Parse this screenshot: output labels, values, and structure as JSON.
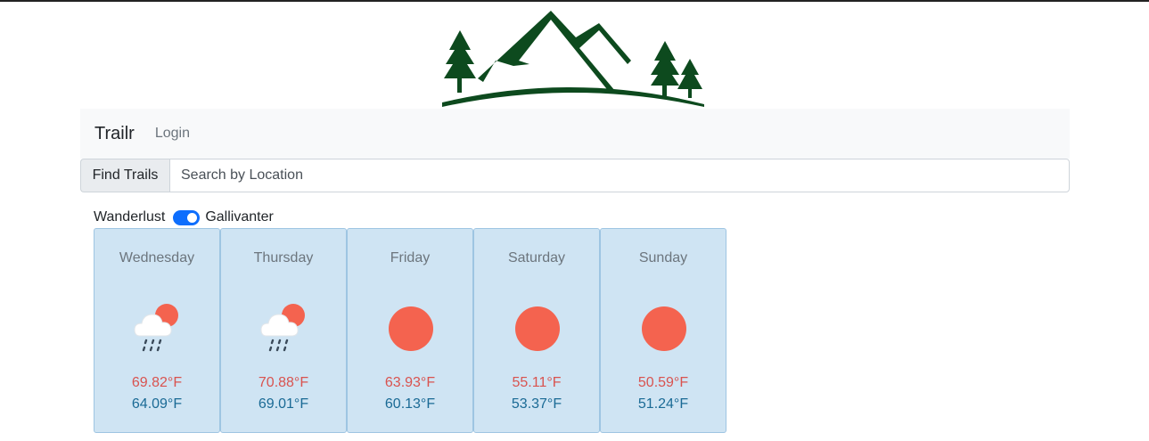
{
  "navbar": {
    "brand": "Trailr",
    "login": "Login"
  },
  "search": {
    "button_label": "Find Trails",
    "placeholder": "Search by Location",
    "value": ""
  },
  "mode_toggle": {
    "left_label": "Wanderlust",
    "right_label": "Gallivanter",
    "checked": true
  },
  "forecast": [
    {
      "day": "Wednesday",
      "icon": "rain-cloud-sun-icon",
      "high": "69.82°F",
      "low": "64.09°F"
    },
    {
      "day": "Thursday",
      "icon": "rain-cloud-sun-icon",
      "high": "70.88°F",
      "low": "69.01°F"
    },
    {
      "day": "Friday",
      "icon": "sun-icon",
      "high": "63.93°F",
      "low": "60.13°F"
    },
    {
      "day": "Saturday",
      "icon": "sun-icon",
      "high": "55.11°F",
      "low": "53.37°F"
    },
    {
      "day": "Sunday",
      "icon": "sun-icon",
      "high": "50.59°F",
      "low": "51.24°F"
    }
  ],
  "colors": {
    "logo_green": "#0d4a1e",
    "toggle_accent": "#0d6efd",
    "card_bg": "#cfe4f3",
    "sun": "#f4634f",
    "temp_high": "#d9534f",
    "temp_low": "#1a6a95"
  }
}
